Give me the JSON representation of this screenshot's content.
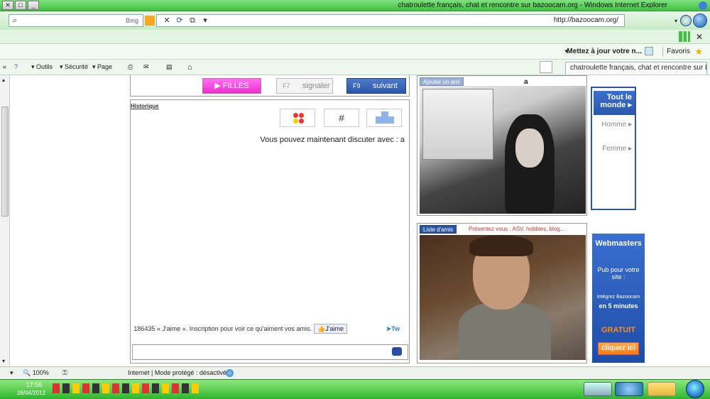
{
  "window": {
    "title": "chatroulette français, chat et rencontre sur bazoocam.org - Windows Internet Explorer",
    "buttons": [
      "✕",
      "□",
      "_"
    ]
  },
  "nav": {
    "address": "http://bazoocam.org/",
    "search_placeholder": "Bing"
  },
  "favorites": {
    "label": "Favoris",
    "update_item": "Mettez à jour votre n..."
  },
  "tab": {
    "label": "chatroulette français, chat et rencontre sur bazoo..."
  },
  "commands": {
    "page": "Page",
    "security": "Sécurité",
    "tools": "Outils"
  },
  "chat": {
    "filles_label": "FILLES",
    "suivant_label": "suivant",
    "suivant_key": "F9",
    "signaler_label": "signaler",
    "signaler_key": "F7",
    "historique": "Historique",
    "message": "Vous pouvez maintenant discuter avec : a",
    "like_button": "J'aime",
    "like_text": "186435 « J'aime ». Inscription pour voir ce qu'aiment vos amis.",
    "tweet": "Tw"
  },
  "cams": {
    "cam1_name": "a",
    "cam1_button": "Ajouter un ami",
    "cam2_button": "Liste d'amis",
    "cam2_caption": "Présentez vous : ASV, hobbies, blog..."
  },
  "sidebar": {
    "items": [
      "Tout le monde",
      "Homme",
      "Femme"
    ]
  },
  "pub": {
    "title": "Webmasters",
    "line1": "Pub pour votre site :",
    "line2": "Intégrez Bazoocam",
    "line3": "en 5 minutes",
    "gratuit": "GRATUIT",
    "cta": "cliquez ici"
  },
  "status": {
    "zone": "Internet | Mode protégé : désactivé",
    "zoom": "100%"
  },
  "clock": {
    "time": "17:56",
    "date": "28/04/2012"
  },
  "colors": {
    "accent_blue": "#2b57ab",
    "pink": "#ec2fcf",
    "chrome_green": "#3fc23f",
    "pub_orange": "#ff8a1a"
  }
}
